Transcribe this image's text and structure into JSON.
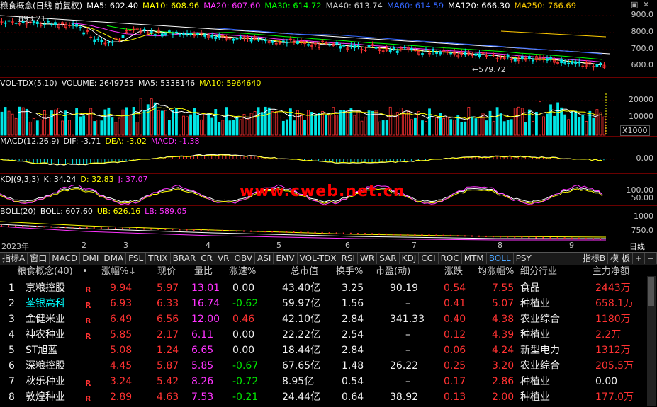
{
  "main_panel": {
    "title": "粮食概念(日线 前复权)",
    "ma": [
      {
        "label": "MA5: 602.40",
        "color": "#ffffff"
      },
      {
        "label": "MA10: 608.96",
        "color": "#ffff00"
      },
      {
        "label": "MA20: 607.60",
        "color": "#ff33ff"
      },
      {
        "label": "MA30: 614.72",
        "color": "#00ff00"
      },
      {
        "label": "MA40: 613.74",
        "color": "#cccccc"
      },
      {
        "label": "MA60: 614.59",
        "color": "#3366ff"
      },
      {
        "label": "MA120: 666.30",
        "color": "#ffffff"
      },
      {
        "label": "MA250: 766.69",
        "color": "#ffcc00"
      }
    ],
    "y_ticks": [
      "900.0",
      "800.0",
      "700.0",
      "600.0"
    ],
    "high_label": "893.21",
    "low_label": "579.72"
  },
  "vol_panel": {
    "title": "VOL-TDX(5,10)",
    "volume": "VOLUME: 2649755",
    "ma5": "MA5: 5338146",
    "ma10": "MA10: 5964640",
    "y_ticks": [
      "20000",
      "10000"
    ],
    "unit": "X1000"
  },
  "macd_panel": {
    "title": "MACD(12,26,9)",
    "dif": "DIF: -3.71",
    "dea": "DEA: -3.02",
    "macd": "MACD: -1.38",
    "y_ticks": [
      "0.00"
    ]
  },
  "kdj_panel": {
    "title": "KDJ(9,3,3)",
    "k": "K: 34.24",
    "d": "D: 32.83",
    "j": "J: 37.07",
    "y_ticks": [
      "100.00",
      "50.00"
    ]
  },
  "boll_panel": {
    "title": "BOLL(20)",
    "boll": "BOLL: 607.60",
    "ub": "UB: 626.16",
    "lb": "LB: 589.05",
    "y_ticks": [
      "1000",
      "750.0"
    ]
  },
  "watermark": "www.cweb.net.cn",
  "x_axis": [
    "2023年",
    "2",
    "3",
    "4",
    "5",
    "6",
    "7",
    "8",
    "9"
  ],
  "period": "日线",
  "tabs": [
    "指标A",
    "窗口",
    "MACD",
    "DMI",
    "DMA",
    "FSL",
    "TRIX",
    "BRAR",
    "CR",
    "VR",
    "OBV",
    "ASI",
    "EMV",
    "VOL-TDX",
    "RSI",
    "WR",
    "SAR",
    "KDJ",
    "CCI",
    "ROC",
    "MTM",
    "BOLL",
    "PSY"
  ],
  "active_tab": "BOLL",
  "tabs_right": [
    "指标B",
    "模 板",
    "+",
    "−"
  ],
  "table": {
    "headers": [
      "粮食概念(40)",
      "•",
      "涨幅%↓",
      "现价",
      "量比",
      "涨速%",
      "总市值",
      "换手%",
      "市盈(动)",
      "涨跌",
      "均涨幅%",
      "细分行业",
      "主力净额"
    ],
    "rows": [
      {
        "no": "1",
        "name": "京粮控股",
        "flag": "R",
        "chg": "9.94",
        "price": "5.97",
        "vr": "13.01",
        "spd": "0.00",
        "mcap": "43.40亿",
        "turn": "3.25",
        "pe": "90.19",
        "delta": "0.54",
        "avg": "7.55",
        "ind": "食品",
        "net": "2443万"
      },
      {
        "no": "2",
        "name": "荃银高科",
        "flag": "R",
        "chg": "6.93",
        "price": "6.33",
        "vr": "16.74",
        "spd": "-0.62",
        "mcap": "59.97亿",
        "turn": "1.56",
        "pe": "–",
        "delta": "0.41",
        "avg": "5.07",
        "ind": "种植业",
        "net": "658.1万"
      },
      {
        "no": "3",
        "name": "金健米业",
        "flag": "R",
        "chg": "6.49",
        "price": "6.56",
        "vr": "12.00",
        "spd": "0.46",
        "mcap": "42.10亿",
        "turn": "2.84",
        "pe": "341.33",
        "delta": "0.40",
        "avg": "4.38",
        "ind": "农业综合",
        "net": "1180万"
      },
      {
        "no": "4",
        "name": "神农种业",
        "flag": "R",
        "chg": "5.85",
        "price": "2.17",
        "vr": "6.11",
        "spd": "0.00",
        "mcap": "22.22亿",
        "turn": "2.54",
        "pe": "–",
        "delta": "0.12",
        "avg": "4.39",
        "ind": "种植业",
        "net": "2.2万"
      },
      {
        "no": "5",
        "name": "ST旭蓝",
        "flag": "",
        "chg": "5.08",
        "price": "1.24",
        "vr": "6.65",
        "spd": "0.00",
        "mcap": "18.44亿",
        "turn": "2.84",
        "pe": "–",
        "delta": "0.06",
        "avg": "4.24",
        "ind": "新型电力",
        "net": "1312万"
      },
      {
        "no": "6",
        "name": "深粮控股",
        "flag": "",
        "chg": "4.45",
        "price": "5.87",
        "vr": "5.85",
        "spd": "-0.67",
        "mcap": "67.65亿",
        "turn": "1.48",
        "pe": "26.22",
        "delta": "0.25",
        "avg": "3.20",
        "ind": "农业综合",
        "net": "205.5万"
      },
      {
        "no": "7",
        "name": "秋乐种业",
        "flag": "R",
        "chg": "3.24",
        "price": "5.42",
        "vr": "8.26",
        "spd": "-0.72",
        "mcap": "8.95亿",
        "turn": "0.54",
        "pe": "–",
        "delta": "0.17",
        "avg": "2.86",
        "ind": "种植业",
        "net": "0.00"
      },
      {
        "no": "8",
        "name": "敦煌种业",
        "flag": "R",
        "chg": "2.89",
        "price": "4.63",
        "vr": "7.53",
        "spd": "-0.21",
        "mcap": "24.44亿",
        "turn": "0.64",
        "pe": "38.92",
        "delta": "0.13",
        "avg": "2.00",
        "ind": "种植业",
        "net": "177.0万"
      }
    ]
  }
}
